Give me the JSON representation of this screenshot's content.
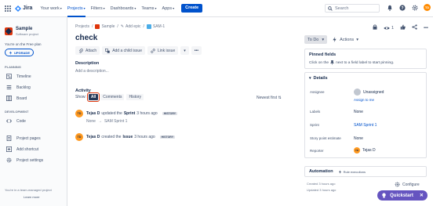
{
  "topnav": {
    "logo_text": "Jira",
    "items": [
      {
        "label": "Your work",
        "active": false
      },
      {
        "label": "Projects",
        "active": true
      },
      {
        "label": "Filters",
        "active": false
      },
      {
        "label": "Dashboards",
        "active": false
      },
      {
        "label": "Teams",
        "active": false
      },
      {
        "label": "Apps",
        "active": false
      }
    ],
    "create_label": "Create",
    "search_placeholder": "Search",
    "avatar_initials": "TD"
  },
  "sidebar": {
    "project_name": "Sample",
    "project_type": "Software project",
    "free_plan_text": "You're on the Free plan",
    "upgrade_label": "UPGRADE",
    "planning_heading": "PLANNING",
    "planning_items": [
      {
        "label": "Timeline",
        "icon": "timeline-icon"
      },
      {
        "label": "Backlog",
        "icon": "backlog-icon"
      },
      {
        "label": "Board",
        "icon": "board-icon"
      }
    ],
    "development_heading": "DEVELOPMENT",
    "development_items": [
      {
        "label": "Code",
        "icon": "code-icon"
      }
    ],
    "bottom_items": [
      {
        "label": "Project pages",
        "icon": "pages-icon"
      },
      {
        "label": "Add shortcut",
        "icon": "add-shortcut-icon"
      },
      {
        "label": "Project settings",
        "icon": "settings-icon"
      }
    ],
    "team_note": "You're in a team-managed project",
    "learn_more": "Learn more"
  },
  "issue": {
    "breadcrumbs": [
      "Projects",
      "Sample",
      "Add epic",
      "SAM-1"
    ],
    "title": "check",
    "actions": [
      "Attach",
      "Add a child issue",
      "Link issue"
    ],
    "description_label": "Description",
    "description_placeholder": "Add a description...",
    "activity_label": "Activity",
    "show_label": "Show:",
    "filters": [
      {
        "label": "All",
        "selected": true
      },
      {
        "label": "Comments",
        "selected": false
      },
      {
        "label": "History",
        "selected": false
      }
    ],
    "sort_label": "Newest first",
    "history": [
      {
        "initials": "TD",
        "user": "Tejas D",
        "verb": "updated the",
        "field": "Sprint",
        "time": "3 hours ago",
        "badge": "HISTORY",
        "from": "None",
        "arrow": "→",
        "to": "SAM Sprint 1"
      },
      {
        "initials": "TD",
        "user": "Tejas D",
        "verb": "created the",
        "field": "Issue",
        "time": "3 hours ago",
        "badge": "HISTORY"
      }
    ]
  },
  "right_panel": {
    "watch_count": "1",
    "status_label": "To Do",
    "actions_label": "Actions",
    "pinned": {
      "heading": "Pinned fields",
      "hint_prefix": "Click on the",
      "hint_suffix": "next to a field label to start pinning."
    },
    "details": {
      "heading": "Details",
      "fields": [
        {
          "label": "Assignee",
          "value": "Unassigned"
        },
        {
          "label": "Labels",
          "value": "None"
        },
        {
          "label": "Sprint",
          "value": "SAM Sprint 1"
        },
        {
          "label": "Story point estimate",
          "value": "None"
        },
        {
          "label": "Reporter",
          "value": "Tejas D"
        }
      ],
      "assign_to_me": "Assign to me"
    },
    "automation": {
      "label": "Automation",
      "rule_label": "Rule executions"
    },
    "created": "Created 3 hours ago",
    "updated": "Updated 3 hours ago",
    "configure_label": "Configure"
  },
  "quickstart_label": "Quickstart",
  "colors": {
    "brand": "#0052cc",
    "quickstart": "#6554c0",
    "avatar": "#ff991f",
    "highlight": "#de350b"
  }
}
